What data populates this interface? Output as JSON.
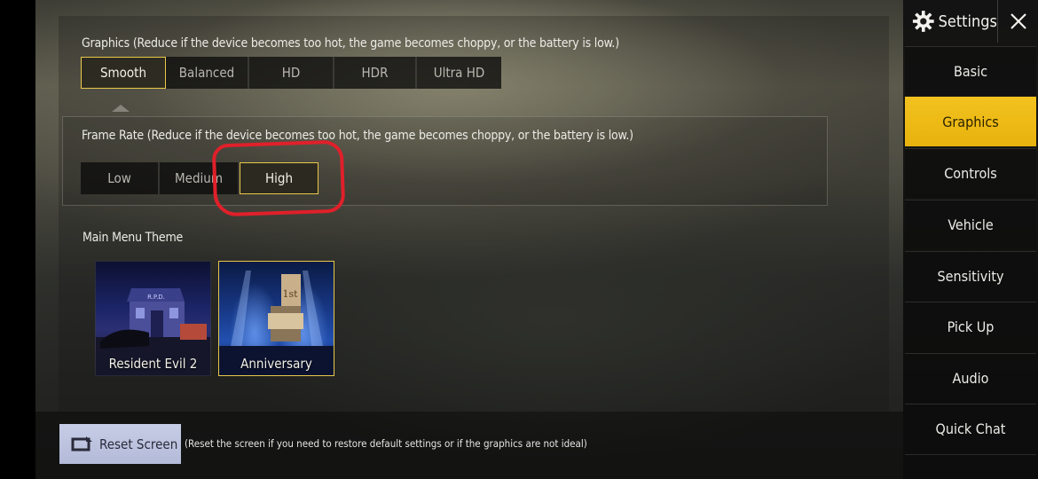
{
  "header": {
    "title": "Settings",
    "close_label": "close"
  },
  "graphics": {
    "title": "Graphics (Reduce if the device becomes too hot, the game becomes choppy, or the battery is low.)",
    "options": [
      "Smooth",
      "Balanced",
      "HD",
      "HDR",
      "Ultra HD"
    ],
    "selected": "Smooth"
  },
  "frame_rate": {
    "title": "Frame Rate (Reduce if the device becomes too hot, the game becomes choppy, or the battery is low.)",
    "options": [
      "Low",
      "Medium",
      "High"
    ],
    "selected": "High"
  },
  "theme": {
    "title": "Main Menu Theme",
    "cards": [
      {
        "label": "Resident Evil 2",
        "selected": false
      },
      {
        "label": "Anniversary",
        "selected": true
      }
    ]
  },
  "footer": {
    "reset_label": "Reset Screen",
    "reset_note": "(Reset the screen if you need to restore default settings or if the graphics are not ideal)"
  },
  "sidebar": {
    "items": [
      {
        "label": "Basic",
        "active": false
      },
      {
        "label": "Graphics",
        "active": true
      },
      {
        "label": "Controls",
        "active": false
      },
      {
        "label": "Vehicle",
        "active": false
      },
      {
        "label": "Sensitivity",
        "active": false
      },
      {
        "label": "Pick Up",
        "active": false
      },
      {
        "label": "Audio",
        "active": false
      },
      {
        "label": "Quick Chat",
        "active": false
      }
    ]
  },
  "colors": {
    "accent": "#e9c84a",
    "active_tab": "#f2c21e",
    "annotation": "#e0202a"
  }
}
